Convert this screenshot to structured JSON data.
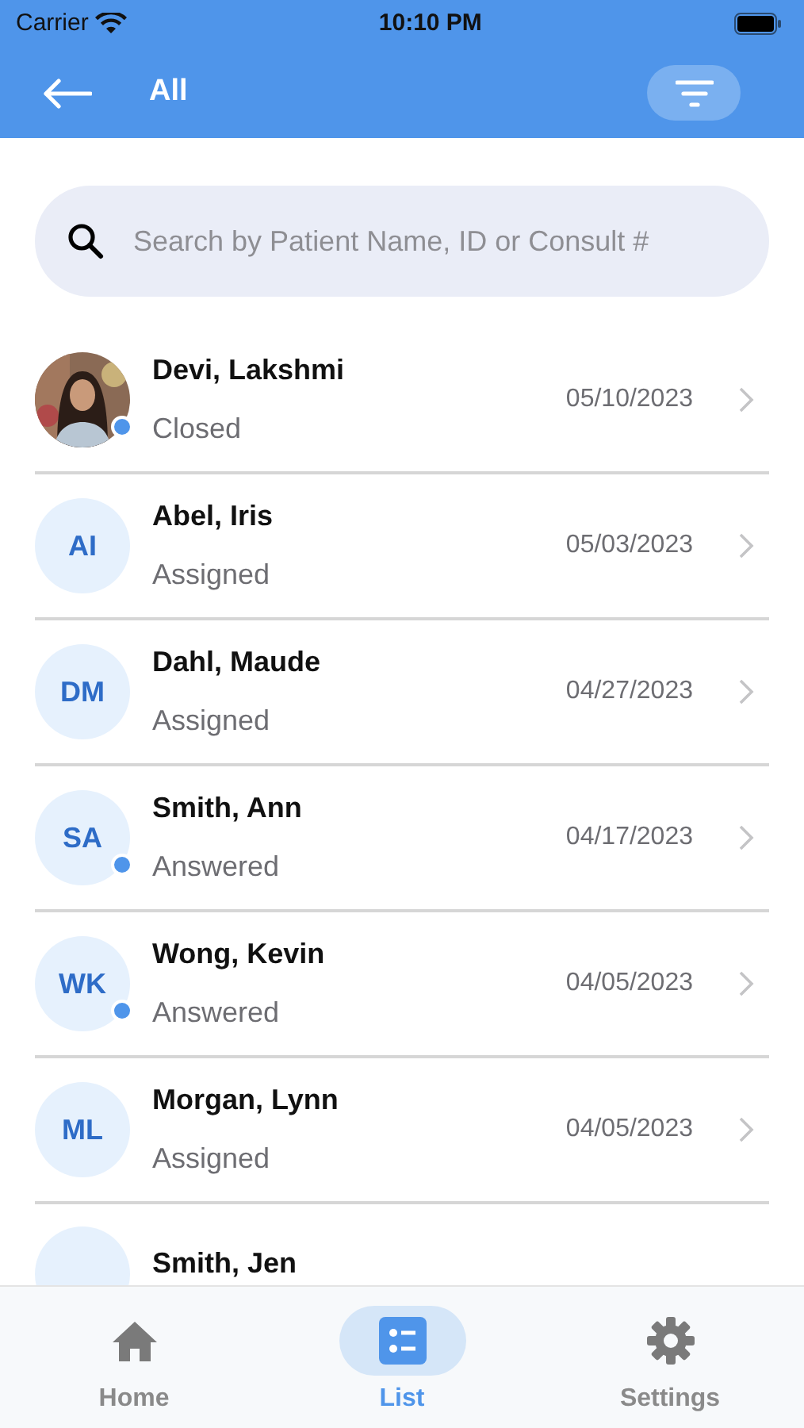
{
  "status_bar": {
    "carrier": "Carrier",
    "time": "10:10 PM"
  },
  "header": {
    "title": "All"
  },
  "search": {
    "placeholder": "Search by Patient Name, ID or Consult #"
  },
  "patients": [
    {
      "name": "Devi, Lakshmi",
      "status": "Closed",
      "date": "05/10/2023",
      "unread": true
    },
    {
      "avatar": {
        "kind": "initials",
        "initials": "AI"
      },
      "name": "Abel, Iris",
      "status": "Assigned",
      "date": "05/03/2023",
      "unread": false
    },
    {
      "avatar": {
        "kind": "initials",
        "initials": "DM"
      },
      "name": "Dahl, Maude",
      "status": "Assigned",
      "date": "04/27/2023",
      "unread": false
    },
    {
      "avatar": {
        "kind": "initials",
        "initials": "SA"
      },
      "name": "Smith, Ann",
      "status": "Answered",
      "date": "04/17/2023",
      "unread": true
    },
    {
      "avatar": {
        "kind": "initials",
        "initials": "WK"
      },
      "name": "Wong, Kevin",
      "status": "Answered",
      "date": "04/05/2023",
      "unread": true
    },
    {
      "avatar": {
        "kind": "initials",
        "initials": "ML"
      },
      "name": "Morgan, Lynn",
      "status": "Assigned",
      "date": "04/05/2023",
      "unread": false
    },
    {
      "avatar": {
        "kind": "initials"
      },
      "name": "Smith, Jen"
    }
  ],
  "tabs": [
    {
      "kind": "home",
      "label": "Home",
      "selected": false
    },
    {
      "kind": "list",
      "label": "List",
      "selected": true
    },
    {
      "kind": "settings",
      "label": "Settings",
      "selected": false
    }
  ]
}
